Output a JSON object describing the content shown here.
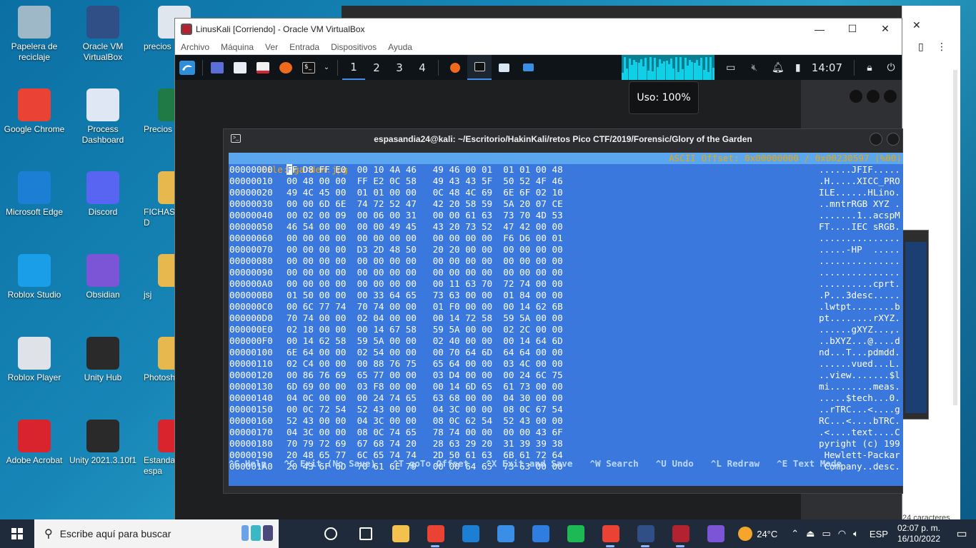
{
  "desktop_icons": [
    {
      "label": "Papelera de reciclaje",
      "icon": "recycle-bin-icon",
      "color": "#9fb8c8"
    },
    {
      "label": "Oracle VM VirtualBox",
      "icon": "virtualbox-icon",
      "color": "#2f4f86"
    },
    {
      "label": "precios",
      "icon": "document-icon",
      "color": "#dfe6ee"
    },
    {
      "label": "Google Chrome",
      "icon": "chrome-icon",
      "color": "#ea4335"
    },
    {
      "label": "Process Dashboard",
      "icon": "dashboard-icon",
      "color": "#dfe7f4"
    },
    {
      "label": "Precios",
      "icon": "excel-icon",
      "color": "#1f7a45"
    },
    {
      "label": "Microsoft Edge",
      "icon": "edge-icon",
      "color": "#1c7fd3"
    },
    {
      "label": "Discord",
      "icon": "discord-icon",
      "color": "#5865f2"
    },
    {
      "label": "FICHAS D",
      "icon": "folder-icon",
      "color": "#e7b84d"
    },
    {
      "label": "Roblox Studio",
      "icon": "roblox-studio-icon",
      "color": "#1a9ee8"
    },
    {
      "label": "Obsidian",
      "icon": "obsidian-icon",
      "color": "#7b55d6"
    },
    {
      "label": "jsj",
      "icon": "folder-icon",
      "color": "#e7b84d"
    },
    {
      "label": "Roblox Player",
      "icon": "roblox-player-icon",
      "color": "#dfe3e8"
    },
    {
      "label": "Unity Hub",
      "icon": "unity-icon",
      "color": "#2a2a2a"
    },
    {
      "label": "Photosh",
      "icon": "photoshop-file-icon",
      "color": "#e7b84d"
    },
    {
      "label": "Adobe Acrobat",
      "icon": "acrobat-icon",
      "color": "#d9232d"
    },
    {
      "label": "Unity 2021.3.10f1",
      "icon": "unity-icon",
      "color": "#2a2a2a"
    },
    {
      "label": "Estandar espa",
      "icon": "pdf-icon",
      "color": "#d9232d"
    }
  ],
  "vbox": {
    "title": "LinusKali [Corriendo] - Oracle VM VirtualBox",
    "menu": [
      "Archivo",
      "Máquina",
      "Ver",
      "Entrada",
      "Dispositivos",
      "Ayuda"
    ]
  },
  "kali_panel": {
    "workspaces": [
      "1",
      "2",
      "3",
      "4"
    ],
    "active_workspace": "1",
    "clock": "14:07",
    "cpu_tooltip": "Uso: 100%",
    "colors": {
      "panel": "#0f1419",
      "accent": "#3f8ef0",
      "graph": "#10d0e8"
    }
  },
  "terminal": {
    "title": "espasandia24@kali: ~/Escritorio/HakinKali/retos Pico CTF/2019/Forensic/Glory of the Garden",
    "status_left": "File: garden.jpg",
    "status_right": "ASCII Offset: 0x00000000 / 0x00230597 (%00)",
    "rows": [
      {
        "off": "00000000",
        "bytes": "FF D8 FF E0  00 10 4A 46   49 46 00 01  01 01 00 48",
        "ascii": "......JFIF....."
      },
      {
        "off": "00000010",
        "bytes": "00 48 00 00  FF E2 0C 58   49 43 43 5F  50 52 4F 46",
        "ascii": ".H.....XICC_PRO"
      },
      {
        "off": "00000020",
        "bytes": "49 4C 45 00  01 01 00 00   0C 48 4C 69  6E 6F 02 10",
        "ascii": "ILE......HLino."
      },
      {
        "off": "00000030",
        "bytes": "00 00 6D 6E  74 72 52 47   42 20 58 59  5A 20 07 CE",
        "ascii": "..mntrRGB XYZ ."
      },
      {
        "off": "00000040",
        "bytes": "00 02 00 09  00 06 00 31   00 00 61 63  73 70 4D 53",
        "ascii": ".......1..acspM"
      },
      {
        "off": "00000050",
        "bytes": "46 54 00 00  00 00 49 45   43 20 73 52  47 42 00 00",
        "ascii": "FT....IEC sRGB."
      },
      {
        "off": "00000060",
        "bytes": "00 00 00 00  00 00 00 00   00 00 00 00  F6 D6 00 01",
        "ascii": "..............."
      },
      {
        "off": "00000070",
        "bytes": "00 00 00 00  D3 2D 48 50   20 20 00 00  00 00 00 00",
        "ascii": ".....-HP  ....."
      },
      {
        "off": "00000080",
        "bytes": "00 00 00 00  00 00 00 00   00 00 00 00  00 00 00 00",
        "ascii": "..............."
      },
      {
        "off": "00000090",
        "bytes": "00 00 00 00  00 00 00 00   00 00 00 00  00 00 00 00",
        "ascii": "..............."
      },
      {
        "off": "000000A0",
        "bytes": "00 00 00 00  00 00 00 00   00 11 63 70  72 74 00 00",
        "ascii": "..........cprt."
      },
      {
        "off": "000000B0",
        "bytes": "01 50 00 00  00 33 64 65   73 63 00 00  01 84 00 00",
        "ascii": ".P...3desc....."
      },
      {
        "off": "000000C0",
        "bytes": "00 6C 77 74  70 74 00 00   01 F0 00 00  00 14 62 6B",
        "ascii": ".lwtpt........b"
      },
      {
        "off": "000000D0",
        "bytes": "70 74 00 00  02 04 00 00   00 14 72 58  59 5A 00 00",
        "ascii": "pt........rXYZ."
      },
      {
        "off": "000000E0",
        "bytes": "02 18 00 00  00 14 67 58   59 5A 00 00  02 2C 00 00",
        "ascii": "......gXYZ...,."
      },
      {
        "off": "000000F0",
        "bytes": "00 14 62 58  59 5A 00 00   02 40 00 00  00 14 64 6D",
        "ascii": "..bXYZ...@....d"
      },
      {
        "off": "00000100",
        "bytes": "6E 64 00 00  02 54 00 00   00 70 64 6D  64 64 00 00",
        "ascii": "nd...T...pdmdd."
      },
      {
        "off": "00000110",
        "bytes": "02 C4 00 00  00 88 76 75   65 64 00 00  03 4C 00 00",
        "ascii": "......vued...L."
      },
      {
        "off": "00000120",
        "bytes": "00 86 76 69  65 77 00 00   03 D4 00 00  00 24 6C 75",
        "ascii": "..view.......$l"
      },
      {
        "off": "00000130",
        "bytes": "6D 69 00 00  03 F8 00 00   00 14 6D 65  61 73 00 00",
        "ascii": "mi........meas."
      },
      {
        "off": "00000140",
        "bytes": "04 0C 00 00  00 24 74 65   63 68 00 00  04 30 00 00",
        "ascii": ".....$tech...0."
      },
      {
        "off": "00000150",
        "bytes": "00 0C 72 54  52 43 00 00   04 3C 00 00  08 0C 67 54",
        "ascii": "..rTRC...<....g"
      },
      {
        "off": "00000160",
        "bytes": "52 43 00 00  04 3C 00 00   08 0C 62 54  52 43 00 00",
        "ascii": "RC...<....bTRC."
      },
      {
        "off": "00000170",
        "bytes": "04 3C 00 00  08 0C 74 65   78 74 00 00  00 00 43 6F",
        "ascii": ".<....text....C"
      },
      {
        "off": "00000180",
        "bytes": "70 79 72 69  67 68 74 20   28 63 29 20  31 39 39 38",
        "ascii": "pyright (c) 199"
      },
      {
        "off": "00000190",
        "bytes": "20 48 65 77  6C 65 74 74   2D 50 61 63  6B 61 72 64",
        "ascii": " Hewlett-Packar"
      },
      {
        "off": "000001A0",
        "bytes": "20 43 6F 6D  70 61 6E 79   00 00 64 65  73 63 00 00",
        "ascii": " Company..desc."
      }
    ],
    "help": [
      "^G Help",
      "^C Exit (No Save)",
      "^T goTo Offset",
      "^X Exit and Save",
      "^W Search",
      "^U Undo",
      "^L Redraw",
      "^E Text Mode"
    ],
    "colors": {
      "hex_bg": "#3b78de",
      "status_bg": "#5aa7f0",
      "status_fg": "#f0a500"
    }
  },
  "background_window": {
    "status_text": "24 caracteres"
  },
  "taskbar": {
    "search_placeholder": "Escribe aquí para buscar",
    "apps": [
      {
        "name": "task-view-icon",
        "color": "#ffffff"
      },
      {
        "name": "widgets-icon",
        "color": "#ffffff"
      },
      {
        "name": "file-explorer-icon",
        "color": "#f2c14e"
      },
      {
        "name": "chrome-icon",
        "color": "#ea4335"
      },
      {
        "name": "edge-icon",
        "color": "#1c7fd3"
      },
      {
        "name": "store-icon",
        "color": "#3a8ee6"
      },
      {
        "name": "mail-icon",
        "color": "#2f7de1"
      },
      {
        "name": "spotify-icon",
        "color": "#1db954"
      },
      {
        "name": "chrome-profile-icon",
        "color": "#ea4335"
      },
      {
        "name": "virtualbox-icon",
        "color": "#2f4f86"
      },
      {
        "name": "linuskali-vm-icon",
        "color": "#b3232f"
      },
      {
        "name": "obsidian-icon",
        "color": "#7b55d6"
      }
    ],
    "weather": "24°C",
    "language": "ESP",
    "time": "02:07 p. m.",
    "date": "16/10/2022"
  }
}
